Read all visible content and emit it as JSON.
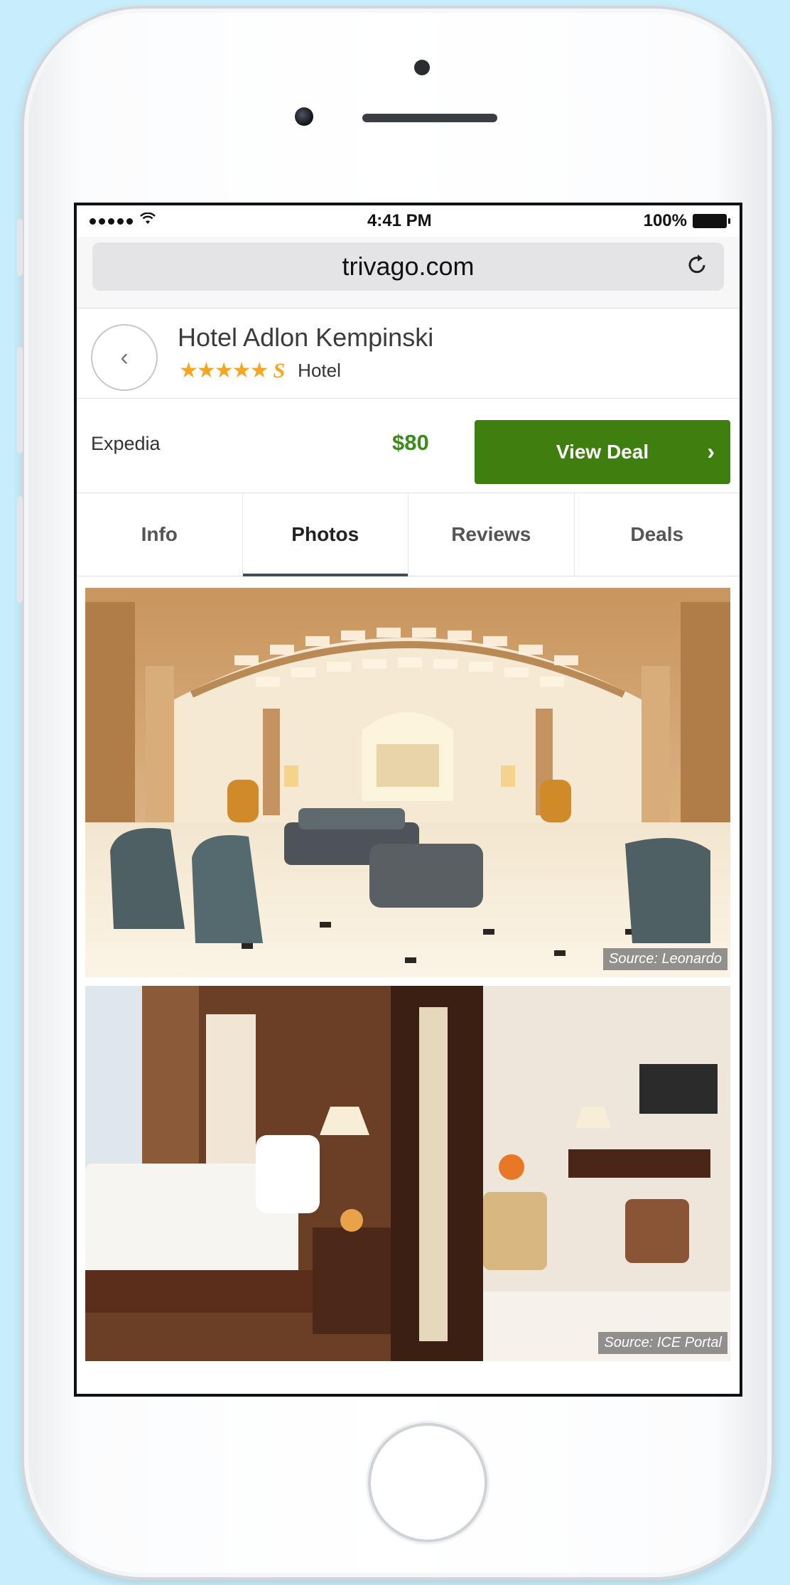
{
  "status_bar": {
    "time": "4:41 PM",
    "battery": "100%"
  },
  "browser": {
    "url": "trivago.com"
  },
  "hotel": {
    "name": "Hotel Adlon Kempinski",
    "stars": "★★★★★",
    "superior": "S",
    "type": "Hotel"
  },
  "deal": {
    "provider": "Expedia",
    "price": "$80",
    "button_label": "View Deal"
  },
  "tabs": [
    {
      "label": "Info",
      "active": false
    },
    {
      "label": "Photos",
      "active": true
    },
    {
      "label": "Reviews",
      "active": false
    },
    {
      "label": "Deals",
      "active": false
    }
  ],
  "photos": [
    {
      "caption": "Source: Leonardo",
      "subject": "hotel-lobby"
    },
    {
      "caption": "Source: ICE Portal",
      "subject": "hotel-room"
    }
  ],
  "colors": {
    "accent_green": "#3f7f0f",
    "price_green": "#3d8b1b",
    "star_orange": "#f5a623"
  }
}
